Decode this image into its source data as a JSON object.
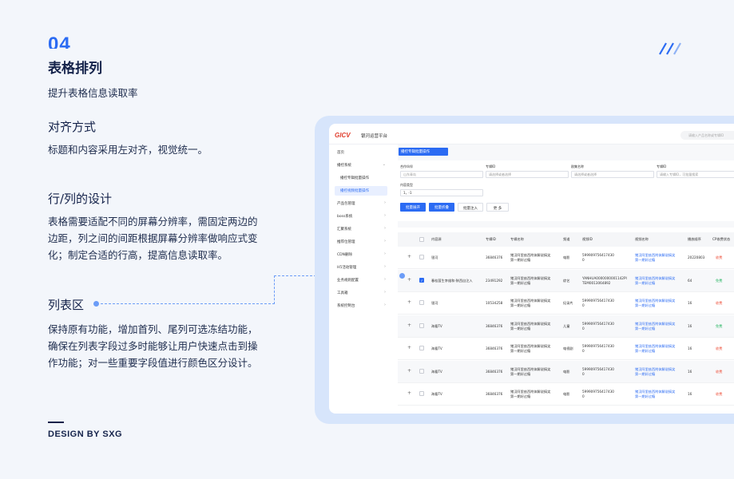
{
  "section": {
    "number": "04",
    "title": "表格排列",
    "subtitle": "提升表格信息读取率"
  },
  "blocks": [
    {
      "heading": "对齐方式",
      "lines": [
        "标题和内容采用左对齐，视觉统一。"
      ]
    },
    {
      "heading": "行/列的设计",
      "lines": [
        "表格需要适配不同的屏幕分辨率，需固定两边的",
        "边距，列之间的间距根据屏幕分辨率做响应式变",
        "化；制定合适的行高，提高信息读取率。"
      ]
    },
    {
      "heading": "列表区",
      "lines": [
        "保持原有功能，增加首列、尾列可选冻结功能，",
        "确保在列表字段过多时能够让用户快速点击到操",
        "作功能；对一些重要字段值进行颜色区分设计。"
      ]
    }
  ],
  "footer": "DESIGN BY SXG",
  "colors": {
    "accent": "#2b6bf3",
    "dark": "#14224a",
    "frame": "#d7e5fb",
    "green": "#22b35e",
    "red": "#ee4f3a"
  },
  "mockup": {
    "logo": "GICV",
    "brand": "银河运营平台",
    "search_placeholder": "请输入产品名称或专辑ID",
    "sidebar": [
      {
        "label": "首页",
        "chevron": ""
      },
      {
        "label": "播控系统",
        "chevron": "⌄"
      },
      {
        "label": "播控专辑批量操作",
        "chevron": ""
      },
      {
        "label": "播控视频批量操作",
        "chevron": ""
      },
      {
        "label": "产品包管理",
        "chevron": "›"
      },
      {
        "label": "boss系统",
        "chevron": "›"
      },
      {
        "label": "汇聚系统",
        "chevron": "›"
      },
      {
        "label": "推荐位管理",
        "chevron": "›"
      },
      {
        "label": "CDN删除",
        "chevron": "›"
      },
      {
        "label": "H5活动管理",
        "chevron": "›"
      },
      {
        "label": "业务规则配置",
        "chevron": "›"
      },
      {
        "label": "工具箱",
        "chevron": "›"
      },
      {
        "label": "系统控制台",
        "chevron": "›"
      }
    ],
    "tab": "播控专辑批量操作",
    "filters": {
      "f1_label": "合作伙伴",
      "f1_value": "山东青岛",
      "f2_label": "专辑ID",
      "f2_value": "请选择或者选择",
      "f3_label": "剧集名称",
      "f3_value": "请选择或者选择",
      "f4_label": "专辑ID",
      "f4_value": "请输入专辑ID，可批量搜索",
      "f5_label": "内容类型",
      "f5_value": "1，-1"
    },
    "buttons": {
      "b1": "批量展开",
      "b2": "批量折叠",
      "b3": "批量注入",
      "b4": "更 多"
    },
    "headers": [
      "内容源",
      "专辑ID",
      "专辑名称",
      "频道",
      "视频ID",
      "视频名称",
      "播放顺序",
      "CP收费状态"
    ],
    "rows": [
      {
        "source": "银河",
        "album_id": "36846376",
        "name1": "猪汉阿里兹西附体解说搞笑",
        "name2": "第一期好过瘾",
        "channel": "电影",
        "vid1": "599909756417430",
        "vid2": "0",
        "vname1": "猪汉阿里兹西附体解说搞笑",
        "vname2": "第一期好过瘾",
        "order": "20220803",
        "fee": "收费",
        "checked": false
      },
      {
        "source": "春桂茵生李维和·陕西自注入",
        "album_id": "23491292",
        "name1": "猪汉阿里兹西附体解说搞笑",
        "name2": "第一期好过瘾",
        "channel": "综艺",
        "vid1": "YANHUA0000000001142PI",
        "vid2": "TEM0013064892",
        "vname1": "猪汉阿里兹西附体解说搞笑",
        "vname2": "第一期好过瘾",
        "order": "64",
        "fee": "免费",
        "checked": true
      },
      {
        "source": "银河",
        "album_id": "10534258",
        "name1": "猪汉阿里兹西附体解说搞笑",
        "name2": "第一期好过瘾",
        "channel": "纪录片",
        "vid1": "599909756417430",
        "vid2": "0",
        "vname1": "猪汉阿里兹西附体解说搞笑",
        "vname2": "第一期好过瘾",
        "order": "16",
        "fee": "收费",
        "checked": false
      },
      {
        "source": "海看TV",
        "album_id": "36846376",
        "name1": "猪汉阿里兹西附体解说搞笑",
        "name2": "第一期好过瘾",
        "channel": "儿童",
        "vid1": "599909756417430",
        "vid2": "0",
        "vname1": "猪汉阿里兹西附体解说搞笑",
        "vname2": "第一期好过瘾",
        "order": "16",
        "fee": "免费",
        "checked": false
      },
      {
        "source": "海看TV",
        "album_id": "36846376",
        "name1": "猪汉阿里兹西附体解说搞笑",
        "name2": "第一期好过瘾",
        "channel": "电视剧",
        "vid1": "599909756417430",
        "vid2": "0",
        "vname1": "猪汉阿里兹西附体解说搞笑",
        "vname2": "第一期好过瘾",
        "order": "16",
        "fee": "收费",
        "checked": false
      },
      {
        "source": "海看TV",
        "album_id": "36846376",
        "name1": "猪汉阿里兹西附体解说搞笑",
        "name2": "第一期好过瘾",
        "channel": "电影",
        "vid1": "599909756417430",
        "vid2": "0",
        "vname1": "猪汉阿里兹西附体解说搞笑",
        "vname2": "第一期好过瘾",
        "order": "16",
        "fee": "收费",
        "checked": false
      },
      {
        "source": "海看TV",
        "album_id": "36846376",
        "name1": "猪汉阿里兹西附体解说搞笑",
        "name2": "第一期好过瘾",
        "channel": "电影",
        "vid1": "599909756417430",
        "vid2": "0",
        "vname1": "猪汉阿里兹西附体解说搞笑",
        "vname2": "第一期好过瘾",
        "order": "16",
        "fee": "收费",
        "checked": false
      }
    ]
  }
}
